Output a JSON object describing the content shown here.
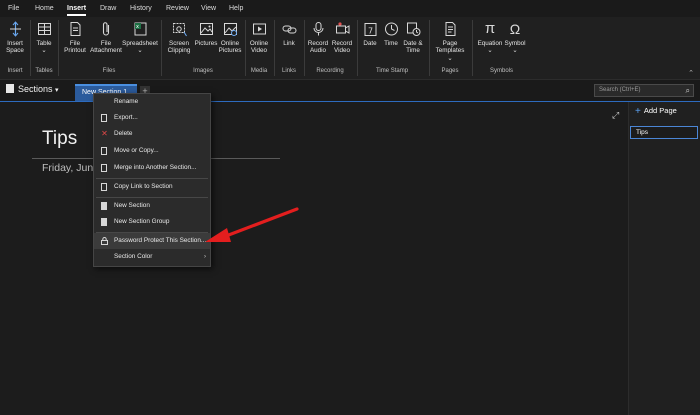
{
  "menu": {
    "tabs": [
      "File",
      "Home",
      "Insert",
      "Draw",
      "History",
      "Review",
      "View",
      "Help"
    ],
    "active": "Insert"
  },
  "ribbon": {
    "insert_space": [
      "Insert",
      "Space"
    ],
    "table": [
      "Table"
    ],
    "file_printout": [
      "File",
      "Printout"
    ],
    "file_attachment": [
      "File",
      "Attachment"
    ],
    "spreadsheet": [
      "Spreadsheet"
    ],
    "screen_clipping": [
      "Screen",
      "Clipping"
    ],
    "pictures": [
      "Pictures"
    ],
    "online_pictures": [
      "Online",
      "Pictures"
    ],
    "online_video": [
      "Online",
      "Video"
    ],
    "link": [
      "Link"
    ],
    "record_audio": [
      "Record",
      "Audio"
    ],
    "record_video": [
      "Record",
      "Video"
    ],
    "date": [
      "Date"
    ],
    "time": [
      "Time"
    ],
    "date_time": [
      "Date &",
      "Time"
    ],
    "page_templates": [
      "Page",
      "Templates"
    ],
    "equation": [
      "Equation"
    ],
    "symbol": [
      "Symbol"
    ],
    "dropdown_caret": "⌄",
    "groups": {
      "insert": "Insert",
      "tables": "Tables",
      "files": "Files",
      "images": "Images",
      "media": "Media",
      "links": "Links",
      "recording": "Recording",
      "time_stamp": "Time Stamp",
      "pages": "Pages",
      "symbols": "Symbols"
    }
  },
  "notebook": {
    "name": "Sections",
    "caret": "▾"
  },
  "section_tab": {
    "label": "New Section 1"
  },
  "add_section": "+",
  "search": {
    "placeholder": "Search (Ctrl+E)"
  },
  "page": {
    "title": "Tips",
    "date": "Friday, June"
  },
  "pagelist": {
    "add_page": "Add Page",
    "items": [
      "Tips"
    ]
  },
  "context_menu": {
    "items": [
      {
        "label": "Rename",
        "icon": "none"
      },
      {
        "label": "Export...",
        "icon": "export-icon"
      },
      {
        "label": "Delete",
        "icon": "delete-x-icon"
      },
      {
        "label": "Move or Copy...",
        "icon": "move-copy-icon"
      },
      {
        "label": "Merge into Another Section...",
        "icon": "merge-icon"
      },
      {
        "label": "Copy Link to Section",
        "icon": "copy-link-icon"
      },
      {
        "label": "New Section",
        "icon": "new-section-icon"
      },
      {
        "label": "New Section Group",
        "icon": "new-section-group-icon"
      },
      {
        "label": "Password Protect This Section...",
        "icon": "lock-icon"
      },
      {
        "label": "Section Color",
        "icon": "none"
      }
    ],
    "submenu_arrow": "›"
  },
  "colors": {
    "accent": "#2b5b9c",
    "annotation": "#e31e1e"
  }
}
